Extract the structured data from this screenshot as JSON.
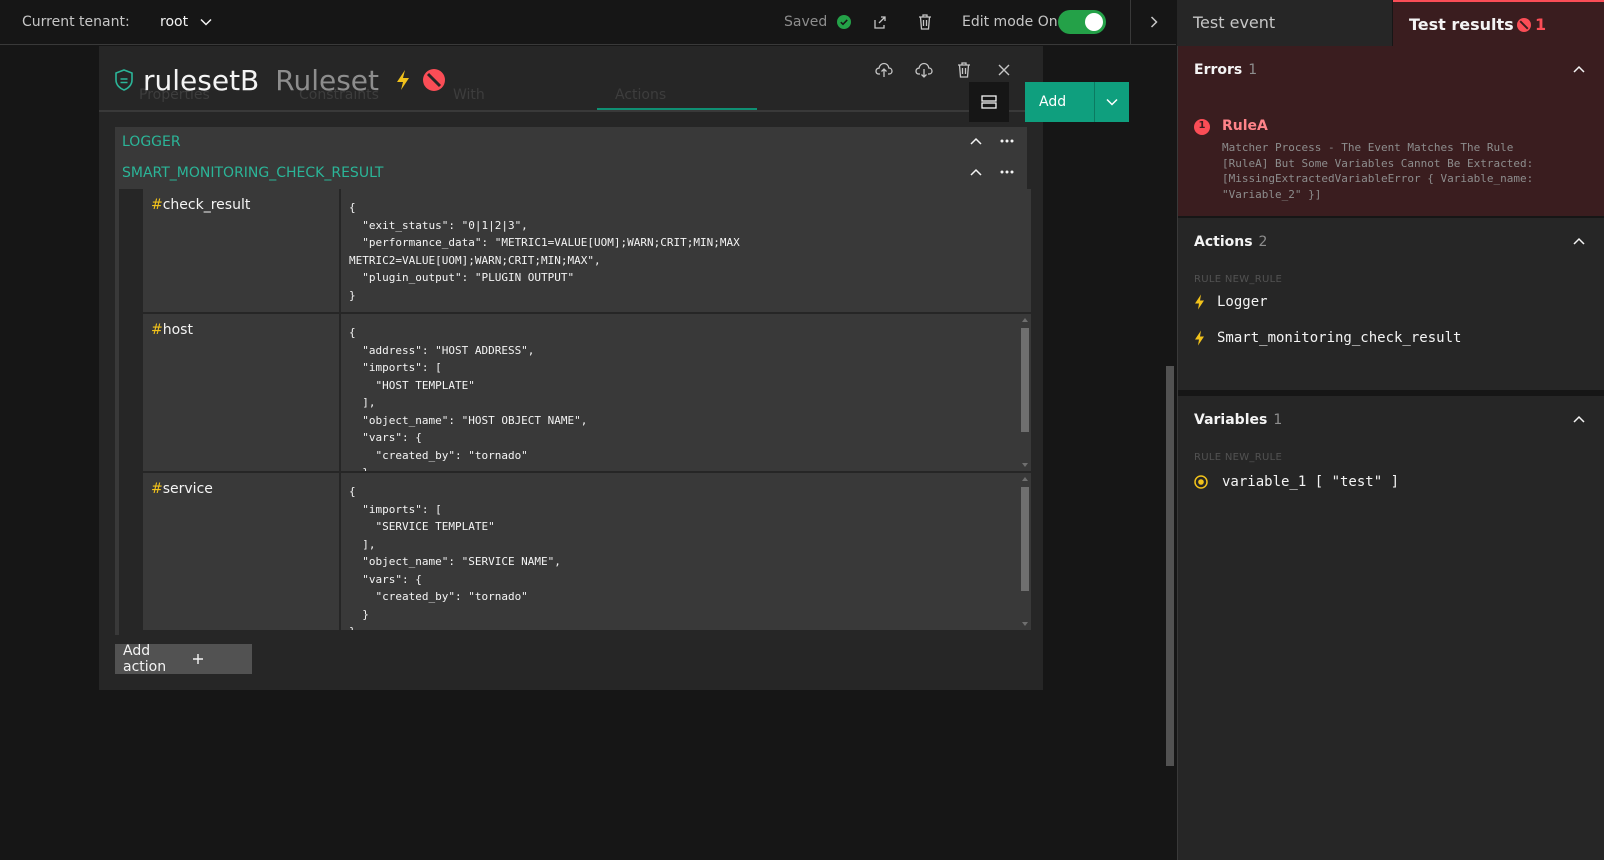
{
  "topbar": {
    "tenant_label": "Current tenant:",
    "tenant_value": "root",
    "saved_label": "Saved",
    "edit_mode_label": "Edit mode On"
  },
  "ruleset": {
    "name": "rulesetB",
    "type": "Ruleset",
    "ghost_tabs": [
      "Properties",
      "Constraints",
      "With",
      "Actions"
    ],
    "add_label": "Add",
    "actions": [
      {
        "label": "LOGGER"
      },
      {
        "label": "SMART_MONITORING_CHECK_RESULT"
      }
    ],
    "params": [
      {
        "name": "check_result",
        "value": "{\n  \"exit_status\": \"0|1|2|3\",\n  \"performance_data\": \"METRIC1=VALUE[UOM];WARN;CRIT;MIN;MAX\nMETRIC2=VALUE[UOM];WARN;CRIT;MIN;MAX\",\n  \"plugin_output\": \"PLUGIN OUTPUT\"\n}"
      },
      {
        "name": "host",
        "value": "{\n  \"address\": \"HOST ADDRESS\",\n  \"imports\": [\n    \"HOST TEMPLATE\"\n  ],\n  \"object_name\": \"HOST OBJECT NAME\",\n  \"vars\": {\n    \"created_by\": \"tornado\"\n  }\n}"
      },
      {
        "name": "service",
        "value": "{\n  \"imports\": [\n    \"SERVICE TEMPLATE\"\n  ],\n  \"object_name\": \"SERVICE NAME\",\n  \"vars\": {\n    \"created_by\": \"tornado\"\n  }\n}"
      }
    ],
    "add_action_label": "Add action"
  },
  "right_panel": {
    "tab_event": "Test event",
    "tab_results": "Test results",
    "results_count": "1",
    "errors": {
      "title": "Errors",
      "count": "1",
      "items": [
        {
          "badge": "1",
          "name": "RuleA",
          "message": "Matcher Process - The Event Matches The Rule\n[RuleA] But Some Variables Cannot Be Extracted:\n[MissingExtractedVariableError { Variable_name:\n\"Variable_2\" }]"
        }
      ]
    },
    "actions": {
      "title": "Actions",
      "count": "2",
      "rule_label": "RULE NEW_RULE",
      "items": [
        "Logger",
        "Smart_monitoring_check_result"
      ]
    },
    "variables": {
      "title": "Variables",
      "count": "1",
      "rule_label": "RULE NEW_RULE",
      "items": [
        "variable_1 [ \"test\" ]"
      ]
    }
  },
  "colors": {
    "accent": "#0f9f7e",
    "teal_text": "#2bb598",
    "error": "#fa4d56",
    "warning": "#f1c21b"
  },
  "icons": [
    "shield-icon",
    "lightning-icon",
    "blocked-icon",
    "upload-icon",
    "download-icon",
    "trash-icon",
    "close-icon",
    "chevron-up-icon",
    "overflow-menu-icon",
    "plus-icon",
    "export-icon",
    "checkmark-icon",
    "chevron-right-icon",
    "radio-icon"
  ]
}
